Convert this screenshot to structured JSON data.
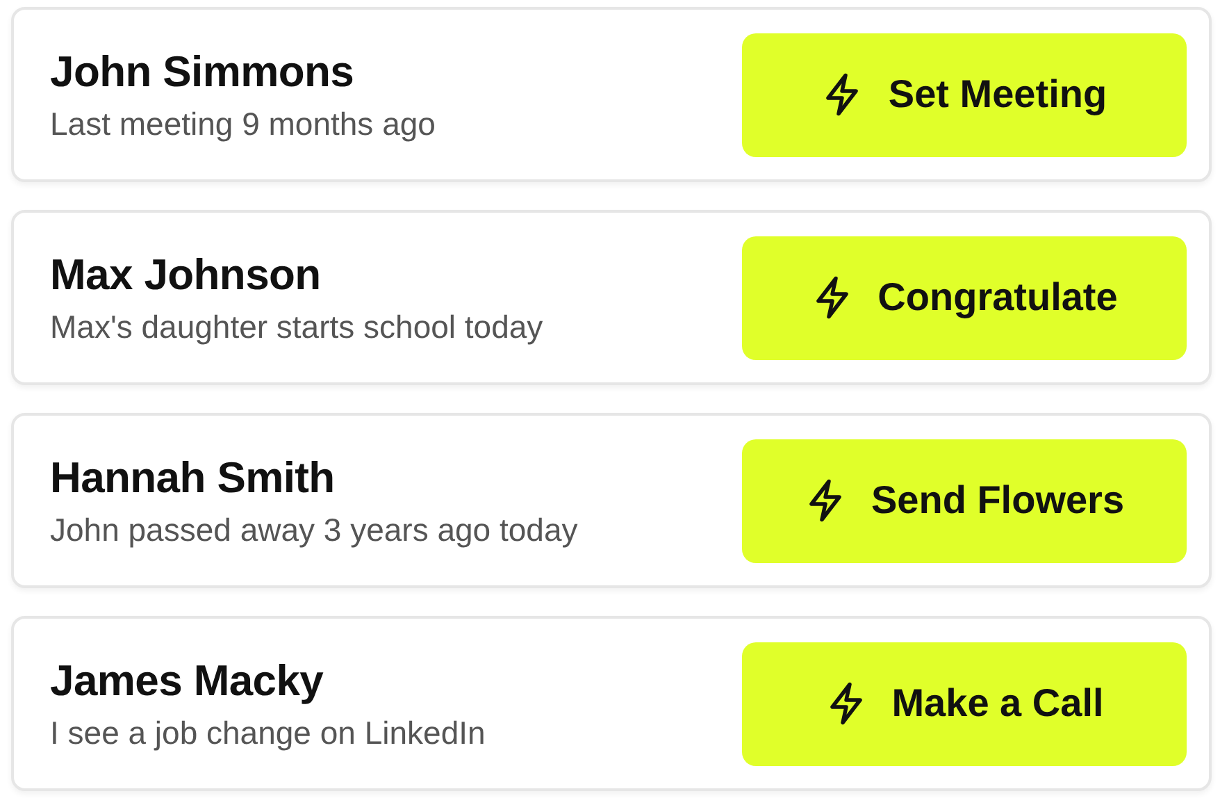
{
  "contacts": [
    {
      "name": "John Simmons",
      "note": "Last meeting 9 months ago",
      "action": "Set Meeting"
    },
    {
      "name": "Max Johnson",
      "note": "Max's daughter starts school today",
      "action": "Congratulate"
    },
    {
      "name": "Hannah Smith",
      "note": "John passed away 3 years ago today",
      "action": "Send Flowers"
    },
    {
      "name": "James Macky",
      "note": "I see a job change on LinkedIn",
      "action": "Make a Call"
    }
  ]
}
